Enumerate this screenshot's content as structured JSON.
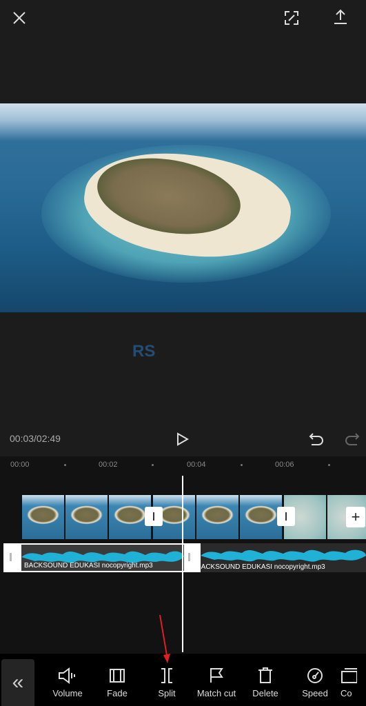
{
  "header": {
    "close_icon": "close-icon",
    "fullscreen_icon": "fullscreen-icon",
    "export_icon": "export-icon"
  },
  "player": {
    "time": "00:03/02:49",
    "play_icon": "play-icon",
    "undo_icon": "undo-icon",
    "redo_icon": "redo-icon"
  },
  "watermark": "RS",
  "timeline": {
    "ruler": [
      "00:00",
      "00:02",
      "00:04",
      "00:06"
    ],
    "audio_clips": [
      {
        "label": "BACKSOUND EDUKASI nocopyright.mp3"
      },
      {
        "label": "BACKSOUND EDUKASI nocopyright.mp3"
      }
    ],
    "add_clip": "+",
    "audio_color": "#1fb2d6"
  },
  "toolbar": {
    "back_icon": "«",
    "items": [
      {
        "label": "Volume"
      },
      {
        "label": "Fade"
      },
      {
        "label": "Split"
      },
      {
        "label": "Match cut"
      },
      {
        "label": "Delete"
      },
      {
        "label": "Speed"
      },
      {
        "label": "Co"
      }
    ]
  }
}
